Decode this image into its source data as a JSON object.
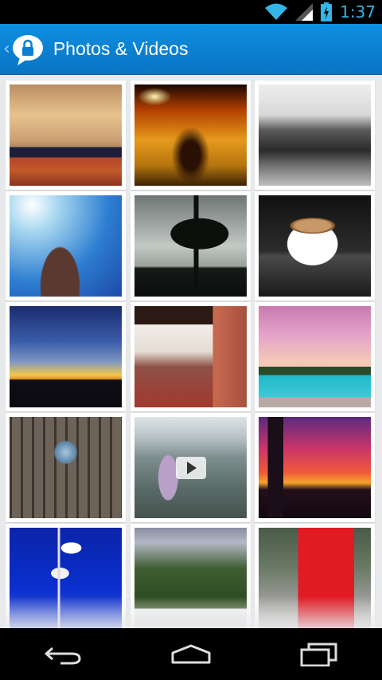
{
  "status_bar": {
    "time": "1:37",
    "icons": [
      "wifi-icon",
      "cell-signal-icon",
      "battery-charging-icon"
    ],
    "accent_color": "#33b5e5"
  },
  "action_bar": {
    "title": "Photos & Videos",
    "up_icon": "chevron-left-icon",
    "app_icon": "chat-lock-icon",
    "background_color": "#0a7fd3"
  },
  "grid": {
    "columns": 3,
    "tiles": [
      {
        "name": "conference-room-photo",
        "type": "photo"
      },
      {
        "name": "night-street-photo",
        "type": "photo"
      },
      {
        "name": "audience-bw-photo",
        "type": "photo"
      },
      {
        "name": "clock-tower-photo",
        "type": "photo"
      },
      {
        "name": "tree-silhouette-photo",
        "type": "photo"
      },
      {
        "name": "coffee-cup-photo",
        "type": "photo"
      },
      {
        "name": "sunset-horizon-photo",
        "type": "photo"
      },
      {
        "name": "veranda-photo",
        "type": "photo"
      },
      {
        "name": "pool-palms-photo",
        "type": "photo"
      },
      {
        "name": "skylight-photo",
        "type": "photo"
      },
      {
        "name": "beach-child-video",
        "type": "video"
      },
      {
        "name": "city-sunset-photo",
        "type": "photo"
      },
      {
        "name": "flags-photo",
        "type": "photo"
      },
      {
        "name": "conservatory-photo",
        "type": "photo"
      },
      {
        "name": "photo-booth-photo",
        "type": "photo"
      }
    ]
  },
  "nav_bar": {
    "buttons": [
      "back-icon",
      "home-icon",
      "recent-apps-icon"
    ]
  }
}
